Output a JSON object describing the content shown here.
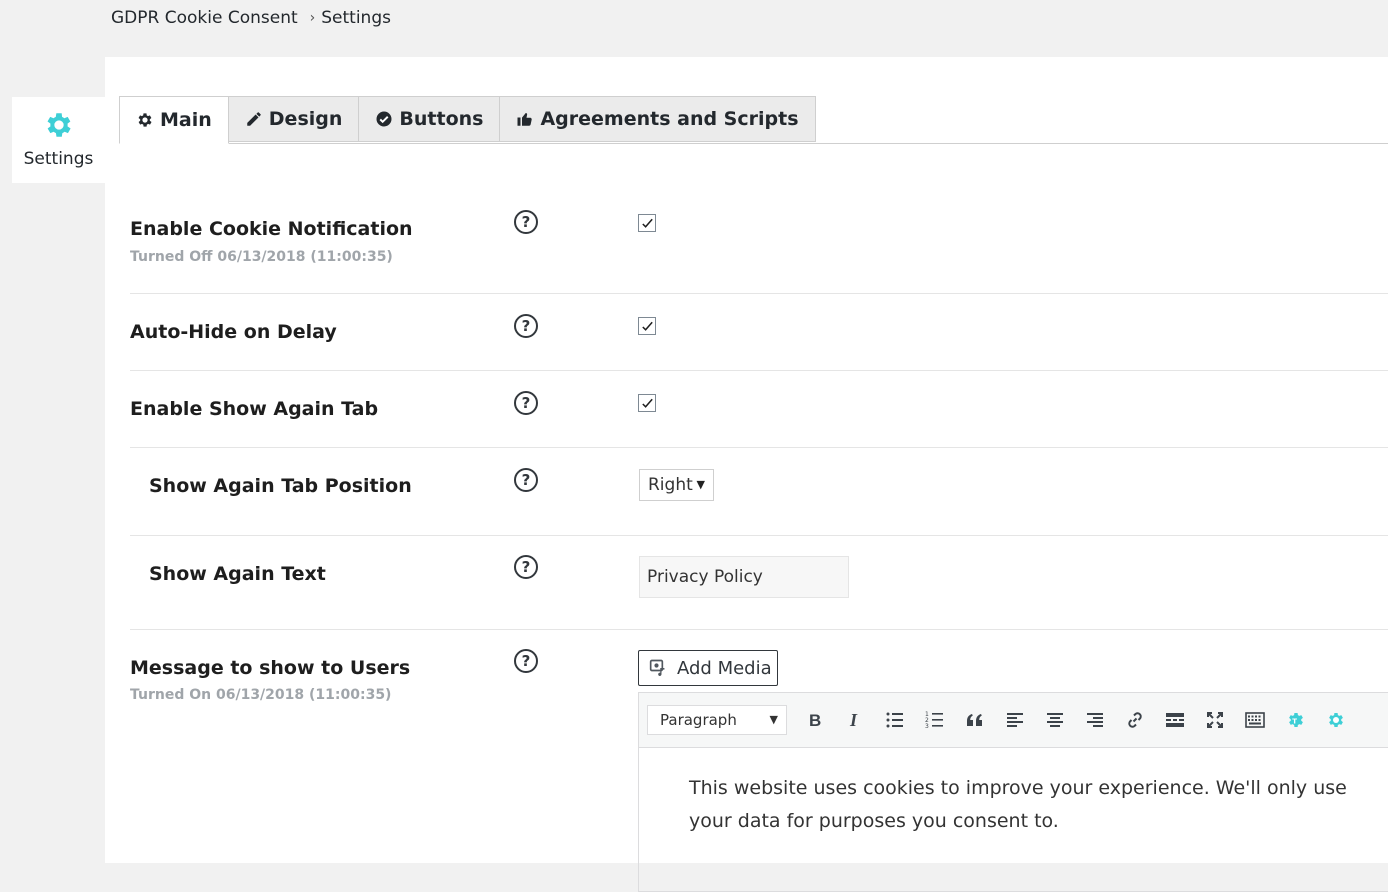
{
  "breadcrumb": {
    "root": "GDPR Cookie Consent",
    "separator": "›",
    "current": "Settings"
  },
  "side_tab": {
    "label": "Settings",
    "icon": "gear-icon",
    "accent": "#3ecfd6"
  },
  "tabs": [
    {
      "label": "Main",
      "icon": "gear-icon",
      "active": true
    },
    {
      "label": "Design",
      "icon": "pencil-icon",
      "active": false
    },
    {
      "label": "Buttons",
      "icon": "check-circle-icon",
      "active": false
    },
    {
      "label": "Agreements and Scripts",
      "icon": "thumbs-up-icon",
      "active": false
    }
  ],
  "settings": {
    "enable_cookie_notification": {
      "title": "Enable Cookie Notification",
      "status": "Turned Off 06/13/2018 (11:00:35)",
      "checked": true
    },
    "auto_hide": {
      "title": "Auto-Hide on Delay",
      "checked": true
    },
    "show_again_tab": {
      "title": "Enable Show Again Tab",
      "checked": true
    },
    "show_again_position": {
      "title": "Show Again Tab Position",
      "value": "Right"
    },
    "show_again_text": {
      "title": "Show Again Text",
      "value": "Privacy Policy"
    },
    "message": {
      "title": "Message to show to Users",
      "status": "Turned On 06/13/2018 (11:00:35)",
      "add_media_label": "Add Media",
      "format_value": "Paragraph",
      "body": "This website uses cookies to improve your experience. We'll only use your data for purposes you consent to."
    }
  },
  "help_symbol": "?",
  "toolbar_icons": [
    "bold-icon",
    "italic-icon",
    "bulleted-list-icon",
    "numbered-list-icon",
    "blockquote-icon",
    "align-left-icon",
    "align-center-icon",
    "align-right-icon",
    "link-icon",
    "read-more-icon",
    "fullscreen-icon",
    "keyboard-icon",
    "translate-icon",
    "gear-icon"
  ]
}
